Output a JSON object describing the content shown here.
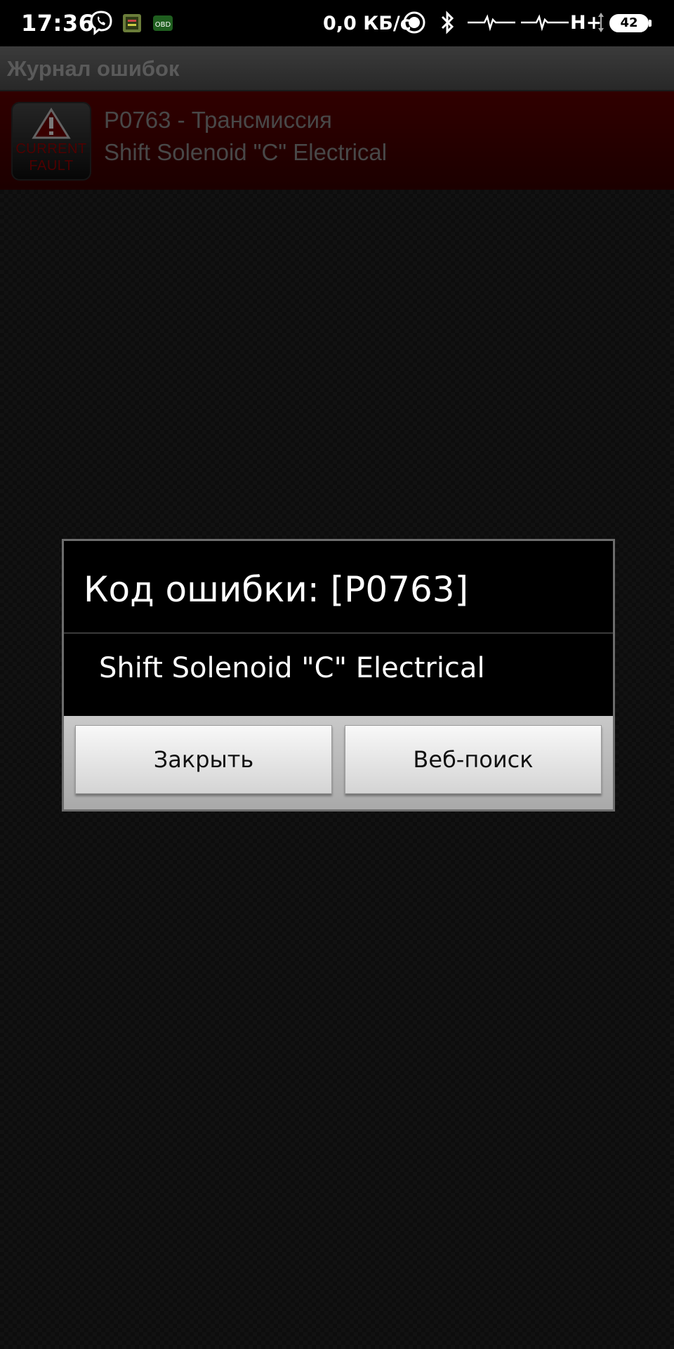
{
  "status_bar": {
    "time": "17:36",
    "net_speed": "0,0 КБ/с",
    "network_type": "H+",
    "battery": "42",
    "icons": [
      "viber-icon",
      "app-icon",
      "obd-icon",
      "sync-icon",
      "bluetooth-icon",
      "signal-icon",
      "signal-icon",
      "data-arrows-icon",
      "battery-icon"
    ],
    "obd_icon_text": "OBD"
  },
  "app": {
    "title": "Журнал ошибок",
    "fault_list": [
      {
        "badge_line1": "CURRENT",
        "badge_line2": "FAULT",
        "title": "P0763 - Трансмиссия",
        "description": "Shift Solenoid \"C\" Electrical"
      }
    ]
  },
  "dialog": {
    "title": "Код ошибки: [P0763]",
    "message": "Shift Solenoid \"C\" Electrical",
    "close_label": "Закрыть",
    "web_search_label": "Веб-поиск"
  },
  "colors": {
    "fault_row": "#3a0000",
    "dialog_bg": "#000000",
    "button_bar": "#b9b9b9"
  }
}
